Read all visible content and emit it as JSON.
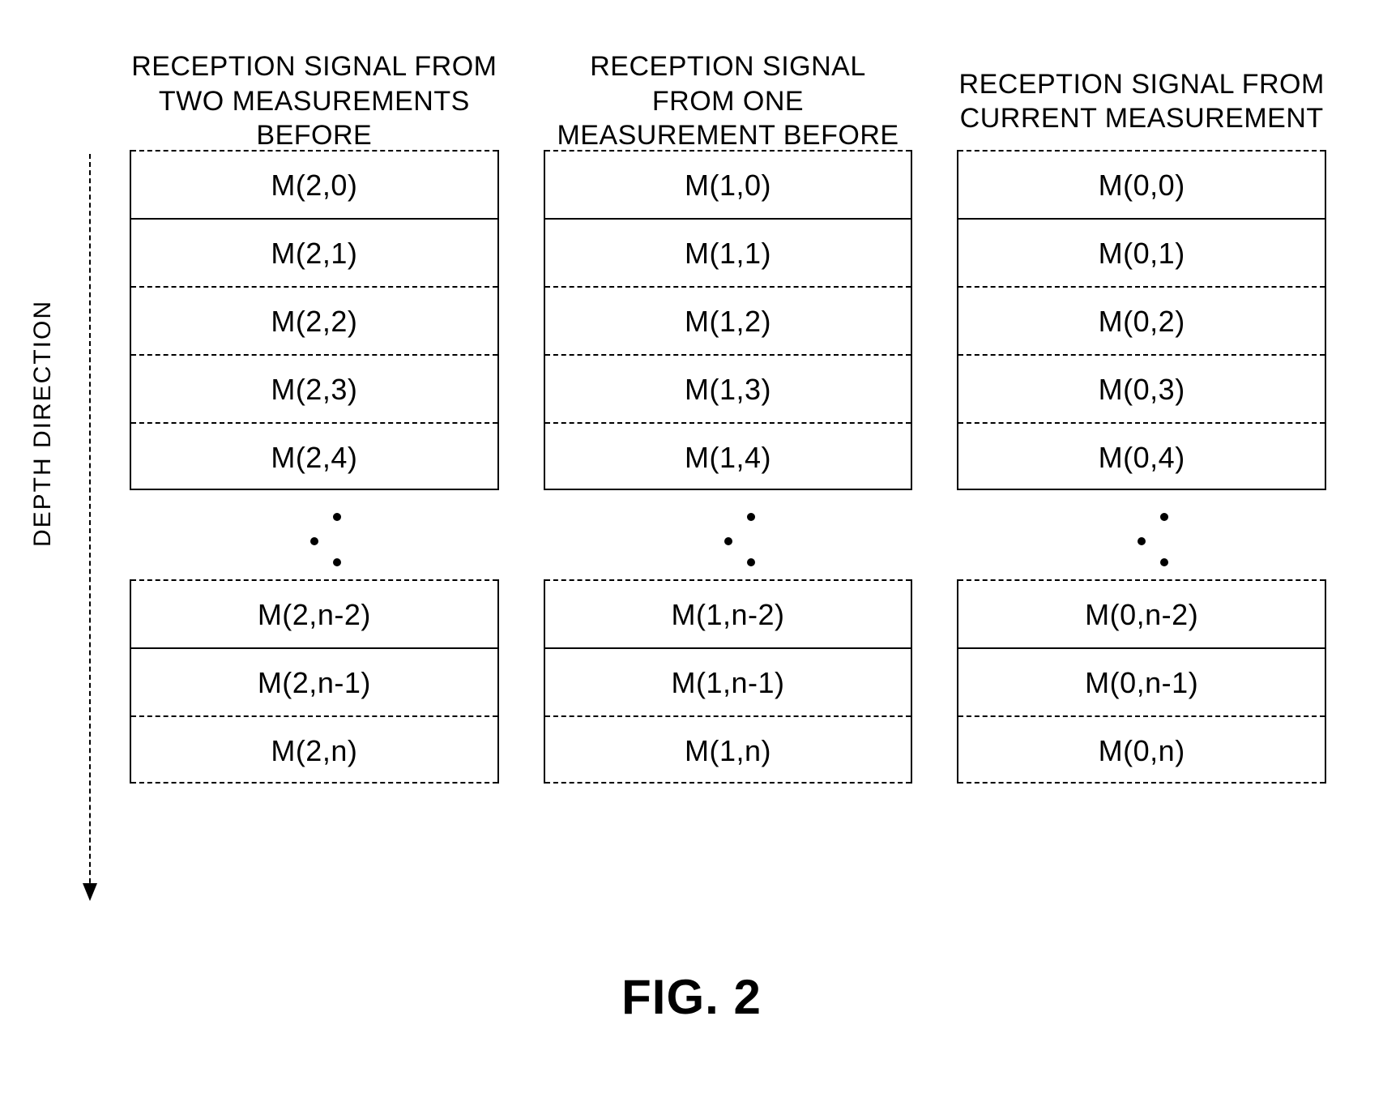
{
  "depth_label": "DEPTH DIRECTION",
  "caption": "FIG. 2",
  "columns": [
    {
      "title": "RECEPTION SIGNAL FROM\nTWO MEASUREMENTS BEFORE",
      "top_rows": [
        "M(2,0)",
        "M(2,1)",
        "M(2,2)",
        "M(2,3)",
        "M(2,4)"
      ],
      "bottom_rows": [
        "M(2,n-2)",
        "M(2,n-1)",
        "M(2,n)"
      ]
    },
    {
      "title": "RECEPTION SIGNAL\nFROM ONE\nMEASUREMENT BEFORE",
      "top_rows": [
        "M(1,0)",
        "M(1,1)",
        "M(1,2)",
        "M(1,3)",
        "M(1,4)"
      ],
      "bottom_rows": [
        "M(1,n-2)",
        "M(1,n-1)",
        "M(1,n)"
      ]
    },
    {
      "title": "RECEPTION SIGNAL FROM\nCURRENT MEASUREMENT",
      "top_rows": [
        "M(0,0)",
        "M(0,1)",
        "M(0,2)",
        "M(0,3)",
        "M(0,4)"
      ],
      "bottom_rows": [
        "M(0,n-2)",
        "M(0,n-1)",
        "M(0,n)"
      ]
    }
  ]
}
